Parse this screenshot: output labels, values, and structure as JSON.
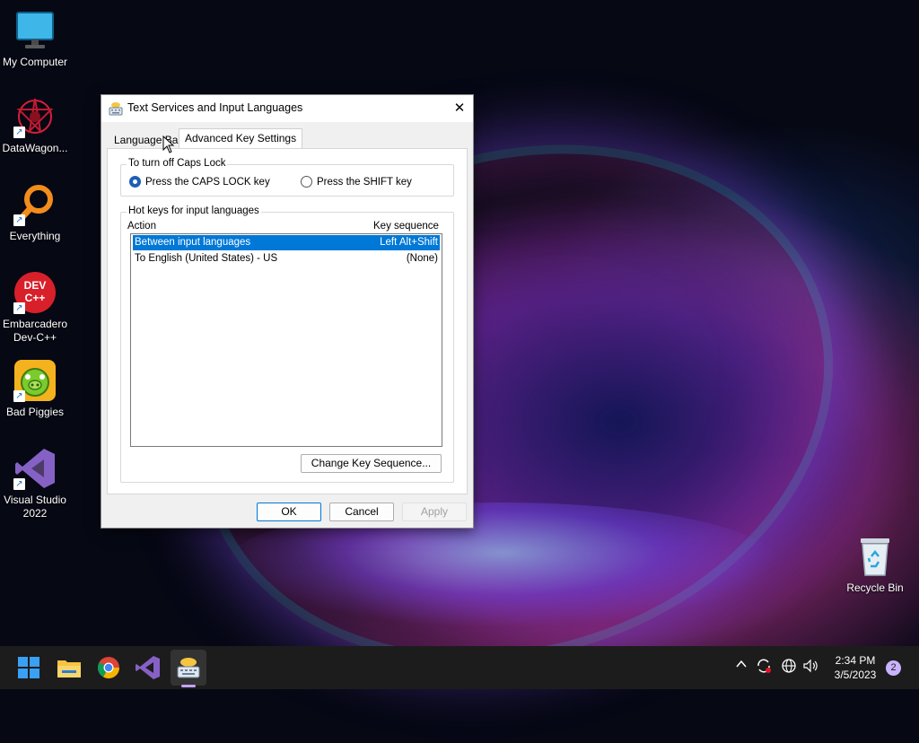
{
  "desktop": {
    "icons": [
      {
        "label": "My Computer"
      },
      {
        "label": "DataWagon..."
      },
      {
        "label": "Everything"
      },
      {
        "label": "Embarcadero Dev-C++"
      },
      {
        "label": "Bad Piggies"
      },
      {
        "label": "Visual Studio 2022"
      },
      {
        "label": "Recycle Bin"
      }
    ],
    "devcpp_logo_text": "DEV C++"
  },
  "dialog": {
    "title": "Text Services and Input Languages",
    "close_glyph": "✕",
    "tabs": [
      {
        "label": "Language Bar",
        "active": false
      },
      {
        "label": "Advanced Key Settings",
        "active": true
      }
    ],
    "caps_group": {
      "label": "To turn off Caps Lock",
      "options": [
        {
          "label": "Press the CAPS LOCK key",
          "selected": true
        },
        {
          "label": "Press the SHIFT key",
          "selected": false
        }
      ]
    },
    "hotkeys_group": {
      "label": "Hot keys for input languages",
      "columns": [
        "Action",
        "Key sequence"
      ],
      "rows": [
        {
          "action": "Between input languages",
          "keys": "Left Alt+Shift",
          "selected": true
        },
        {
          "action": "To English (United States) - US",
          "keys": "(None)",
          "selected": false
        }
      ],
      "change_button": "Change Key Sequence..."
    },
    "buttons": {
      "ok": "OK",
      "cancel": "Cancel",
      "apply": "Apply"
    }
  },
  "taskbar": {
    "apps": [
      "windows-start",
      "file-explorer",
      "chrome",
      "visual-studio",
      "text-services"
    ],
    "clock": {
      "time": "2:34 PM",
      "date": "3/5/2023"
    },
    "notification_count": "2",
    "accent_color": "#0078d7"
  }
}
